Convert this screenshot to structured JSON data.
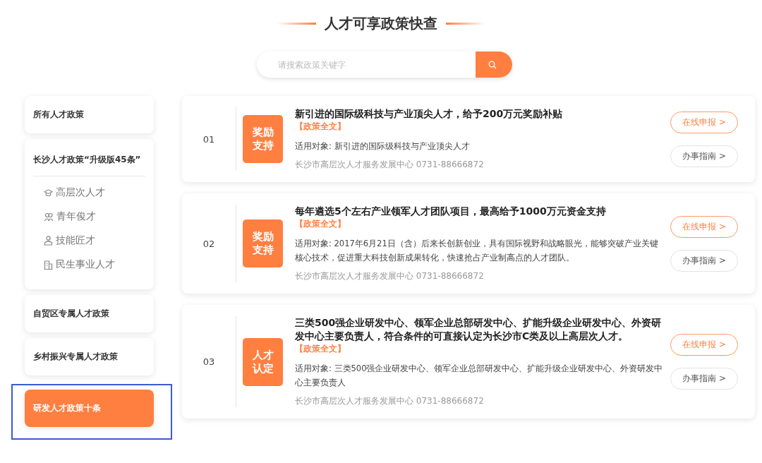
{
  "header": {
    "title": "人才可享政策快查"
  },
  "search": {
    "placeholder": "请搜索政策关键字"
  },
  "sidebar": {
    "groups": [
      {
        "label": "所有人才政策",
        "selected": false
      },
      {
        "label": "长沙人才政策“升级版45条”",
        "selected": false,
        "children": [
          {
            "label": "高层次人才",
            "kind": "cap"
          },
          {
            "label": "青年俊才",
            "kind": "people"
          },
          {
            "label": "技能匠才",
            "kind": "worker"
          },
          {
            "label": "民生事业人才",
            "kind": "building"
          }
        ]
      },
      {
        "label": "自贸区专属人才政策",
        "selected": false
      },
      {
        "label": "乡村振兴专属人才政策",
        "selected": false
      },
      {
        "label": "研发人才政策十条",
        "selected": true
      }
    ]
  },
  "policies": [
    {
      "index": "01",
      "tag": [
        "奖励",
        "支持"
      ],
      "title": "新引进的国际级科技与产业顶尖人才，给予200万元奖励补贴",
      "link": "【政策全文】",
      "target": "适用对象: 新引进的国际级科技与产业顶尖人才",
      "contact": "长沙市高层次人才服务发展中心  0731-88666872",
      "apply": "在线申报 >",
      "guide": "办事指南 >"
    },
    {
      "index": "02",
      "tag": [
        "奖励",
        "支持"
      ],
      "title": "每年遴选5个左右产业领军人才团队项目，最高给予1000万元资金支持",
      "link": "【政策全文】",
      "target": "适用对象: 2017年6月21日（含）后来长创新创业，具有国际视野和战略眼光，能够突破产业关键核心技术，促进重大科技创新成果转化，快速抢占产业制高点的人才团队。",
      "contact": "长沙市高层次人才服务发展中心  0731-88666872",
      "apply": "在线申报 >",
      "guide": "办事指南 >"
    },
    {
      "index": "03",
      "tag": [
        "人才",
        "认定"
      ],
      "title": "三类500强企业研发中心、领军企业总部研发中心、扩能升级企业研发中心、外资研发中心主要负责人，符合条件的可直接认定为长沙市C类及以上高层次人才。",
      "link": "【政策全文】",
      "target": "适用对象: 三类500强企业研发中心、领军企业总部研发中心、扩能升级企业研发中心、外资研发中心主要负责人",
      "contact": "长沙市高层次人才服务发展中心  0731-88666872",
      "apply": "在线申报 >",
      "guide": "办事指南 >"
    }
  ]
}
